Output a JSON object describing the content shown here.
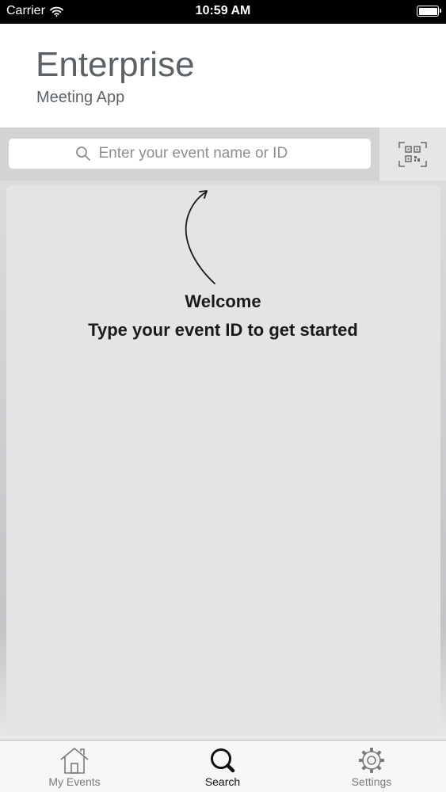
{
  "status_bar": {
    "carrier": "Carrier",
    "time": "10:59 AM"
  },
  "header": {
    "title": "Enterprise",
    "subtitle": "Meeting App"
  },
  "search": {
    "placeholder": "Enter your event name or ID",
    "value": ""
  },
  "content": {
    "welcome": "Welcome",
    "instruction": "Type your event ID to get started"
  },
  "tabs": [
    {
      "label": "My Events",
      "icon": "home-icon",
      "active": false
    },
    {
      "label": "Search",
      "icon": "search-icon",
      "active": true
    },
    {
      "label": "Settings",
      "icon": "gear-icon",
      "active": false
    }
  ],
  "colors": {
    "header_text": "#5c6266",
    "tab_active": "#111111",
    "tab_inactive": "#7a7a7a"
  }
}
